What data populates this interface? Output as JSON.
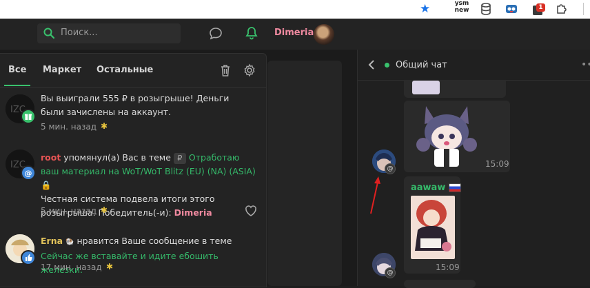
{
  "browser": {
    "extensions": {
      "vsm_label_top": "ysm",
      "vsm_label_bottom": "new",
      "notif_badge": "1",
      "star_icon": "star-icon",
      "puzzle_icon": "puzzle-icon"
    }
  },
  "header": {
    "search_placeholder": "Поиск...",
    "username": "Dimeria"
  },
  "notifications": {
    "tabs": [
      "Все",
      "Маркет",
      "Остальные"
    ],
    "items": [
      {
        "text": "Вы выиграли 555 ₽ в розыгрыше! Деньги были зачислены на аккаунт.",
        "time": "5 мин. назад",
        "badge_type": "gift"
      },
      {
        "user": "root",
        "action": " упомянул(а) Вас в теме ",
        "prefix": "₽",
        "topic": "Отработаю ваш материал на WoT/WoT Blitz (EU) (NA) (ASIA)",
        "lock": "🔒",
        "line2": "Честная система подвела итоги этого розыгрыша. Победитель(-и): ",
        "winner": "Dimeria",
        "time": "5 мин. назад",
        "badge_type": "mention"
      },
      {
        "user": "Erna",
        "action": " нравится Ваше сообщение в теме",
        "topic": "Сейчас же вставайте и идите ебошить железки.",
        "time": "17 мин. назад",
        "badge_type": "like"
      }
    ]
  },
  "chat": {
    "title": "Общий чат",
    "messages": [
      {
        "time": "15:09"
      },
      {
        "author": "aawaw",
        "flag": "🇷🇺",
        "time": "15:09"
      }
    ]
  },
  "colors": {
    "accent_green": "#39c26d",
    "username_pink": "#f08aa0",
    "mention_red": "#e65454",
    "star_yellow": "#e6c33d",
    "arrow_red": "#e02020"
  }
}
